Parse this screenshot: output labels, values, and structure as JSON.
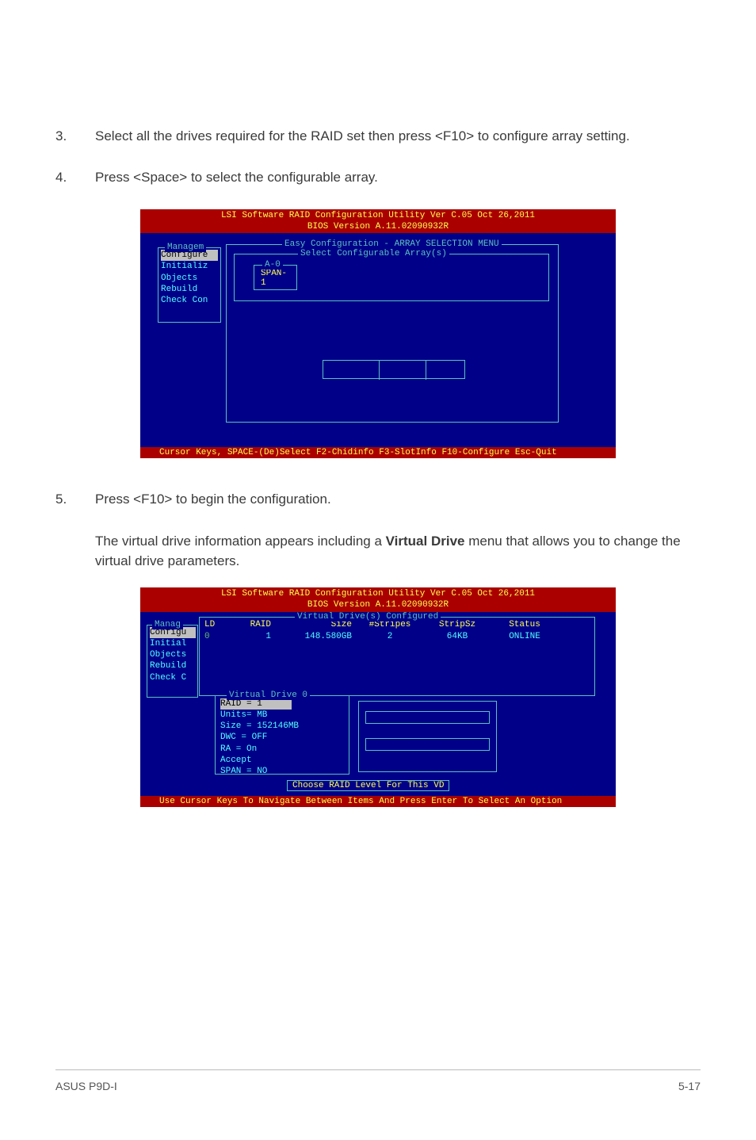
{
  "steps": {
    "s3_num": "3.",
    "s3_text": "Select all the drives required for the RAID set then press <F10> to configure array setting.",
    "s4_num": "4.",
    "s4_text": "Press <Space> to select the configurable array.",
    "s5_num": "5.",
    "s5_text": "Press <F10> to begin the configuration.",
    "s5_sub_a": "The virtual drive information appears including a ",
    "s5_sub_bold": "Virtual Drive",
    "s5_sub_b": " menu that allows you to change the virtual drive parameters."
  },
  "bios1": {
    "title1": "LSI Software RAID Configuration Utility Ver C.05 Oct 26,2011",
    "title2": "BIOS Version  A.11.02090932R",
    "managem_label": "Managem",
    "managem_items": {
      "i0": "Configure",
      "i1": "Initializ",
      "i2": "Objects",
      "i3": "Rebuild",
      "i4": "Check Con"
    },
    "outer_label": "Easy Configuration - ARRAY SELECTION MENU",
    "inner_label": "Select Configurable Array(s)",
    "a0_label": "A-0",
    "a0_text": "SPAN-1",
    "footer": "Cursor Keys, SPACE-(De)Select F2-Chidinfo F3-SlotInfo F10-Configure Esc-Quit"
  },
  "bios2": {
    "title1": "LSI Software RAID Configuration Utility Ver C.05 Oct 26,2011",
    "title2": "BIOS Version  A.11.02090932R",
    "manag_label": "Manag",
    "manag_items": {
      "i0": "Configu",
      "i1": "Initial",
      "i2": "Objects",
      "i3": "Rebuild",
      "i4": "Check C"
    },
    "vdc_label": "Virtual Drive(s) Configured",
    "vdc_headers": {
      "ld": "LD",
      "raid": "RAID",
      "size": "Size",
      "stripes": "#Stripes",
      "stripsz": "StripSz",
      "status": "Status"
    },
    "vdc_data": {
      "ld": "0",
      "raid": "1",
      "size": "148.580GB",
      "stripes": "2",
      "stripsz": "64KB",
      "status": "ONLINE"
    },
    "vd0_label": "Virtual Drive 0",
    "vd0_lines": {
      "l0": "RAID = 1",
      "l1": "Units= MB",
      "l2": "Size = 152146MB",
      "l3": "DWC  = OFF",
      "l4": "RA   = On",
      "l5": "Accept",
      "l6": "SPAN = NO"
    },
    "choose": "Choose RAID Level For This VD",
    "footer": "Use Cursor Keys To Navigate Between Items And Press Enter To Select An Option"
  },
  "doc_footer": {
    "left": "ASUS P9D-I",
    "right": "5-17"
  }
}
